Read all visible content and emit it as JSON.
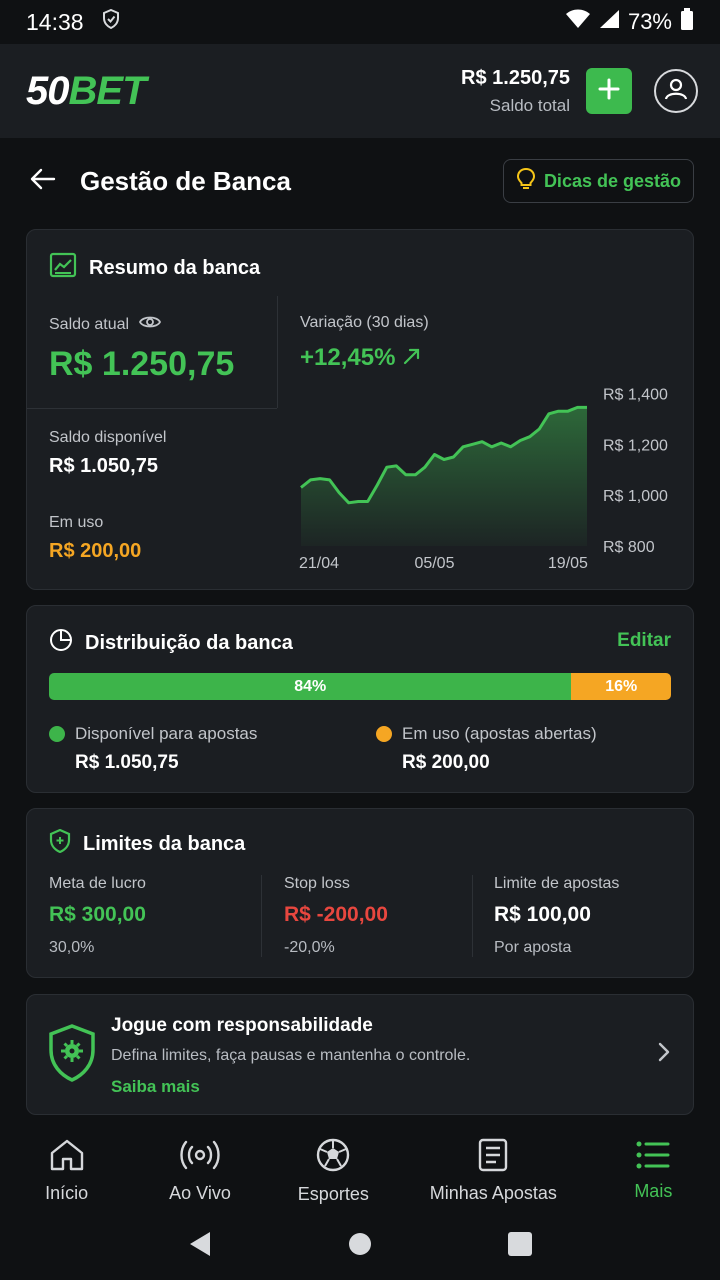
{
  "status": {
    "time": "14:38",
    "battery": "73%"
  },
  "header": {
    "logo_part1": "50",
    "logo_part2": "BET",
    "balance": "R$ 1.250,75",
    "balance_label": "Saldo total"
  },
  "page": {
    "title": "Gestão de Banca",
    "tips_label": "Dicas de gestão"
  },
  "summary": {
    "title": "Resumo da banca",
    "current_label": "Saldo atual",
    "current_value": "R$ 1.250,75",
    "available_label": "Saldo disponível",
    "available_value": "R$ 1.050,75",
    "in_use_label": "Em uso",
    "in_use_value": "R$ 200,00",
    "variation_label": "Variação (30 dias)",
    "variation_value": "+12,45%"
  },
  "chart_data": {
    "type": "area",
    "y_tick_labels": [
      "R$ 1,400",
      "R$ 1,200",
      "R$ 1,000",
      "R$ 800"
    ],
    "y_ticks": [
      1400,
      1200,
      1000,
      800
    ],
    "ylim": [
      800,
      1500
    ],
    "x_tick_labels": [
      "21/04",
      "05/05",
      "19/05"
    ],
    "x_tick_index": [
      0,
      14,
      28
    ],
    "grid": false,
    "color": "#43c356",
    "values": [
      1030,
      1060,
      1065,
      1060,
      1010,
      970,
      975,
      975,
      1040,
      1110,
      1115,
      1080,
      1080,
      1110,
      1160,
      1140,
      1150,
      1190,
      1200,
      1210,
      1190,
      1205,
      1190,
      1215,
      1230,
      1260,
      1320,
      1330,
      1330,
      1345,
      1345
    ]
  },
  "distribution": {
    "title": "Distribuição da banca",
    "edit_label": "Editar",
    "available_pct": 84,
    "available_pct_label": "84%",
    "in_use_pct_label": "16%",
    "available_label": "Disponível para apostas",
    "available_value": "R$ 1.050,75",
    "in_use_label": "Em uso (apostas abertas)",
    "in_use_value": "R$ 200,00",
    "green": "#3db44a",
    "orange": "#f5a623"
  },
  "limits": {
    "title": "Limites da banca",
    "profit_label": "Meta de lucro",
    "profit_value": "R$ 300,00",
    "profit_pct": "30,0%",
    "stop_label": "Stop loss",
    "stop_value": "R$ -200,00",
    "stop_pct": "-20,0%",
    "bet_label": "Limite de apostas",
    "bet_value": "R$ 100,00",
    "bet_sub": "Por aposta"
  },
  "responsible": {
    "title": "Jogue com responsabilidade",
    "desc": "Defina limites, faça pausas e mantenha o controle.",
    "link": "Saiba mais"
  },
  "nav": {
    "home": "Início",
    "live": "Ao Vivo",
    "sports": "Esportes",
    "bets": "Minhas Apostas",
    "more": "Mais"
  },
  "icons": [
    "shield-status-icon",
    "wifi-icon",
    "signal-icon",
    "battery-icon",
    "plus-icon",
    "user-icon",
    "back-arrow-icon",
    "lightbulb-icon",
    "chart-icon",
    "eye-icon",
    "trend-up-icon",
    "pie-chart-icon",
    "shield-limit-icon",
    "shield-gear-icon",
    "chevron-right-icon",
    "home-icon",
    "live-icon",
    "soccer-ball-icon",
    "receipt-icon",
    "menu-icon"
  ]
}
